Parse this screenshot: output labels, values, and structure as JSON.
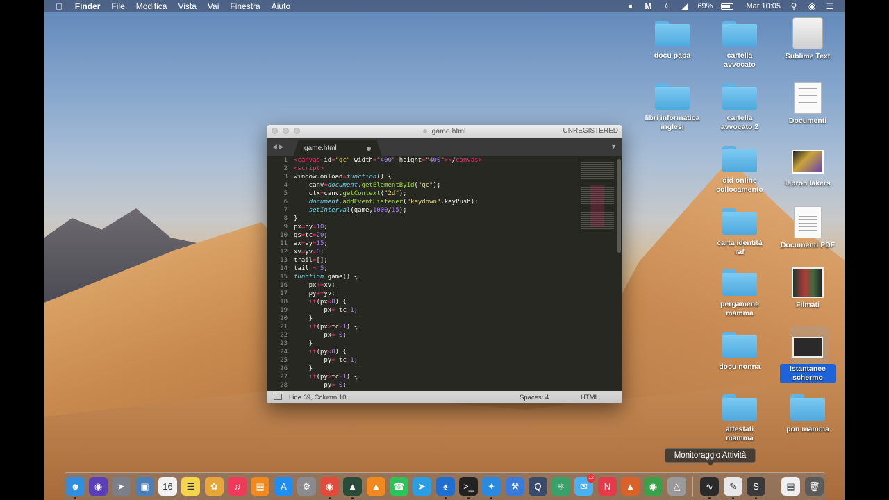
{
  "menubar": {
    "app": "Finder",
    "items": [
      "File",
      "Modifica",
      "Vista",
      "Vai",
      "Finestra",
      "Aiuto"
    ],
    "battery": "69%",
    "clock": "Mar 10:05"
  },
  "desktop_icons": [
    {
      "label": "docu papa",
      "kind": "folder"
    },
    {
      "label": "cartella avvocato",
      "kind": "folder"
    },
    {
      "label": "Sublime Text",
      "kind": "drive"
    },
    {
      "label": "libri informatica inglesi",
      "kind": "folder"
    },
    {
      "label": "cartella avvocato 2",
      "kind": "folder"
    },
    {
      "label": "Documenti",
      "kind": "file"
    },
    {
      "label": "did online collocamento",
      "kind": "folder"
    },
    {
      "label": "lebron lakers",
      "kind": "photo"
    },
    {
      "label": "carta identità raf",
      "kind": "folder"
    },
    {
      "label": "Documenti PDF",
      "kind": "file"
    },
    {
      "label": "pergamene mamma",
      "kind": "folder"
    },
    {
      "label": "Filmati",
      "kind": "video"
    },
    {
      "label": "docu nonna",
      "kind": "folder"
    },
    {
      "label": "Istantanee schermo",
      "kind": "shot"
    },
    {
      "label": "attestati mamma",
      "kind": "folder"
    },
    {
      "label": "pon mamma",
      "kind": "folder"
    }
  ],
  "editor": {
    "title": "game.html",
    "unregistered": "UNREGISTERED",
    "tab": "game.html",
    "status_position": "Line 69, Column 10",
    "status_spaces": "Spaces: 4",
    "status_syntax": "HTML",
    "line_numbers": [
      "1",
      "2",
      "3",
      "4",
      "5",
      "6",
      "7",
      "8",
      "9",
      "10",
      "11",
      "12",
      "13",
      "14",
      "15",
      "16",
      "17",
      "18",
      "19",
      "20",
      "21",
      "22",
      "23",
      "24",
      "25",
      "26",
      "27",
      "28"
    ],
    "code_lines": [
      "<canvas id=\"gc\" width=\"400\" height=\"400\"></canvas>",
      "<script>",
      "window.onload=function() {",
      "    canv=document.getElementById(\"gc\");",
      "    ctx=canv.getContext(\"2d\");",
      "    document.addEventListener(\"keydown\",keyPush);",
      "    setInterval(game,1000/15);",
      "}",
      "px=py=10;",
      "gs=tc=20;",
      "ax=ay=15;",
      "xv=yv=0;",
      "trail=[];",
      "tail = 5;",
      "function game() {",
      "    px+=xv;",
      "    py+=yv;",
      "    if(px<0) {",
      "        px= tc-1;",
      "    }",
      "    if(px>tc-1) {",
      "        px= 0;",
      "    }",
      "    if(py<0) {",
      "        py= tc-1;",
      "    }",
      "    if(py>tc-1) {",
      "        py= 0;"
    ]
  },
  "tooltip": "Monitoraggio Attività",
  "dock": {
    "apps": [
      {
        "name": "finder-icon",
        "color": "#2f8ee0"
      },
      {
        "name": "siri-icon",
        "color": "#5a3fb8"
      },
      {
        "name": "launchpad-icon",
        "color": "#7a7f8a"
      },
      {
        "name": "preview-icon",
        "color": "#4b7fb5"
      },
      {
        "name": "calendar-icon",
        "color": "#f2f2f2"
      },
      {
        "name": "notes-icon",
        "color": "#f5d64a"
      },
      {
        "name": "photos-icon",
        "color": "#e8a53a"
      },
      {
        "name": "music-icon",
        "color": "#f03a5a"
      },
      {
        "name": "books-icon",
        "color": "#f08a1e"
      },
      {
        "name": "appstore-icon",
        "color": "#1f8ef0"
      },
      {
        "name": "settings-icon",
        "color": "#8a8a8f"
      },
      {
        "name": "chrome-icon",
        "color": "#e24a3b"
      },
      {
        "name": "editor-icon",
        "color": "#2a4a3a"
      },
      {
        "name": "vlc-icon",
        "color": "#f08a1e"
      },
      {
        "name": "whatsapp-icon",
        "color": "#2fc25a"
      },
      {
        "name": "telegram-icon",
        "color": "#2a9ee0"
      },
      {
        "name": "spades-icon",
        "color": "#1f6fd0"
      },
      {
        "name": "terminal-icon",
        "color": "#222222"
      },
      {
        "name": "safari-icon",
        "color": "#2a8ae0"
      },
      {
        "name": "xcode-icon",
        "color": "#3a7ad8"
      },
      {
        "name": "quicktime-icon",
        "color": "#3a4a6a"
      },
      {
        "name": "atom-icon",
        "color": "#3aa06a"
      },
      {
        "name": "messages-icon",
        "color": "#4ab0f0"
      },
      {
        "name": "news-icon",
        "color": "#e53a4a"
      },
      {
        "name": "matlab-icon",
        "color": "#d8622a"
      },
      {
        "name": "globe-icon",
        "color": "#3aa04a"
      },
      {
        "name": "cone-icon",
        "color": "#9a9a9a"
      },
      {
        "name": "activity-monitor-icon",
        "color": "#2a2a2a"
      },
      {
        "name": "textedit-icon",
        "color": "#e8e8e8"
      },
      {
        "name": "sublime-icon",
        "color": "#3a3a3a"
      }
    ],
    "messages_badge": "12",
    "right_items": [
      {
        "name": "documents-stack-icon",
        "color": "#f0f0f0"
      },
      {
        "name": "trash-icon",
        "color": "#5a5a5a"
      }
    ]
  }
}
